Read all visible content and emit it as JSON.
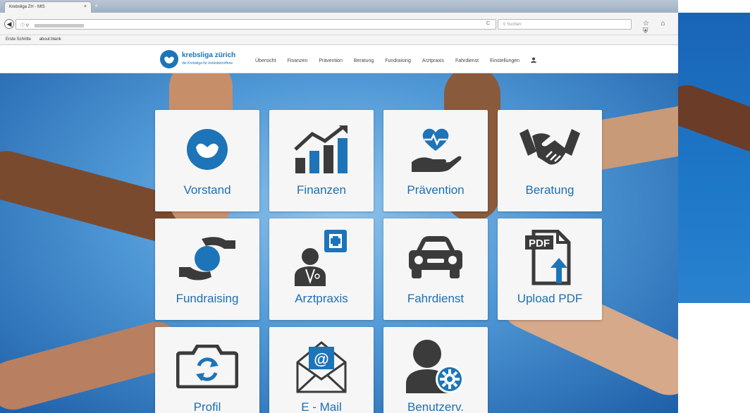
{
  "browser": {
    "tab_title": "Krebsliga ZH - MIS",
    "tab_close": "×",
    "new_tab": "+",
    "search_placeholder": "Suchen",
    "reload": "C",
    "url_lock": "ⓘ ⚲",
    "back": "◀",
    "bookmarks": [
      "Erste Schritte",
      "about:blank"
    ],
    "toolbar_icons": "☆ ⌂ ⛨"
  },
  "site": {
    "logo_name": "krebsliga zürich",
    "logo_tagline": "die Krebsliga für krebsbetroffene",
    "nav": [
      "Übersicht",
      "Finanzen",
      "Prävention",
      "Beratung",
      "Fundraising",
      "Arztpraxis",
      "Fahrdienst",
      "Einstellungen"
    ],
    "user_icon": "user-icon"
  },
  "tiles": [
    {
      "label": "Vorstand",
      "icon": "krebsliga-logo-icon"
    },
    {
      "label": "Finanzen",
      "icon": "bar-chart-growth-icon"
    },
    {
      "label": "Prävention",
      "icon": "heart-hand-icon"
    },
    {
      "label": "Beratung",
      "icon": "handshake-icon"
    },
    {
      "label": "Fundraising",
      "icon": "hands-holding-icon"
    },
    {
      "label": "Arztpraxis",
      "icon": "doctor-plus-icon"
    },
    {
      "label": "Fahrdienst",
      "icon": "car-icon"
    },
    {
      "label": "Upload PDF",
      "icon": "pdf-upload-icon"
    },
    {
      "label": "Profil",
      "icon": "camera-refresh-icon"
    },
    {
      "label": "E - Mail",
      "icon": "email-icon"
    },
    {
      "label": "Benutzerv.",
      "icon": "user-gear-icon"
    }
  ],
  "colors": {
    "accent": "#1d74b8",
    "icon_dark": "#3b3b3b",
    "tile_bg": "#f6f6f6"
  }
}
